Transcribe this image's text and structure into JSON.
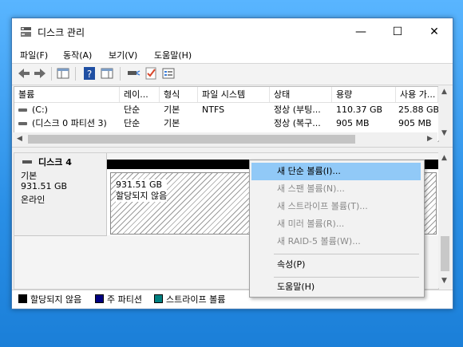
{
  "window": {
    "title": "디스크 관리"
  },
  "controls": {
    "minimize": "—",
    "maximize": "☐",
    "close": "✕"
  },
  "menu": [
    "파일(F)",
    "동작(A)",
    "보기(V)",
    "도움말(H)"
  ],
  "volumes": {
    "columns": [
      "볼륨",
      "레이...",
      "형식",
      "파일 시스템",
      "상태",
      "용량",
      "사용 가..."
    ],
    "rows": [
      {
        "volume": "(C:)",
        "layout": "단순",
        "type": "기본",
        "fs": "NTFS",
        "status": "정상 (부팅...",
        "capacity": "110.37 GB",
        "free": "25.88 GB"
      },
      {
        "volume": "(디스크 0 파티션 3)",
        "layout": "단순",
        "type": "기본",
        "fs": "",
        "status": "정상 (복구...",
        "capacity": "905 MB",
        "free": "905 MB"
      }
    ]
  },
  "disk": {
    "name": "디스크 4",
    "type": "기본",
    "size": "931.51 GB",
    "state": "온라인"
  },
  "partition": {
    "size": "931.51 GB",
    "status": "할당되지 않음"
  },
  "legend": [
    {
      "label": "할당되지 않음",
      "color": "#000000"
    },
    {
      "label": "주 파티션",
      "color": "#000080"
    },
    {
      "label": "스트라이프 볼륨",
      "color": "#008080"
    }
  ],
  "context_menu": {
    "new_simple": "새 단순 볼륨(I)...",
    "new_spanned": "새 스팬 볼륨(N)...",
    "new_striped": "새 스트라이프 볼륨(T)...",
    "new_mirror": "새 미러 볼륨(R)...",
    "new_raid5": "새 RAID-5 볼륨(W)...",
    "properties": "속성(P)",
    "help": "도움말(H)"
  }
}
